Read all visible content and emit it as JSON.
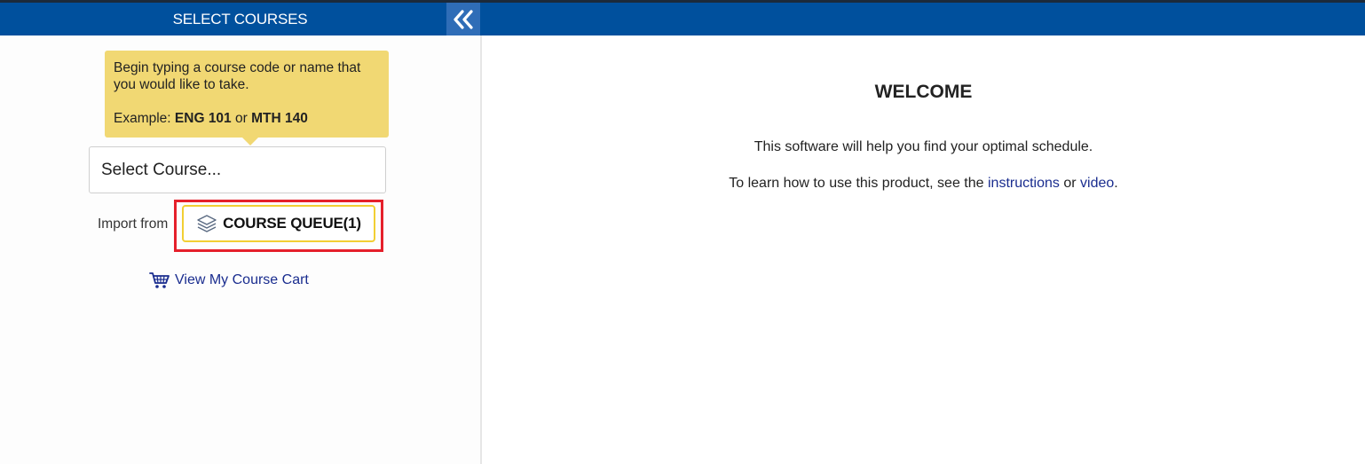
{
  "header": {
    "title": "SELECT COURSES",
    "collapse_icon": "double-chevron-left-icon"
  },
  "sidebar": {
    "tooltip": {
      "line1": "Begin typing a course code or name that you would like to take.",
      "example_prefix": "Example: ",
      "example_code1": "ENG 101",
      "example_or": " or ",
      "example_code2": "MTH 140"
    },
    "select_placeholder": "Select Course...",
    "import_label": "Import from",
    "queue_button_label": "COURSE QUEUE(1)",
    "queue_icon": "layers-icon",
    "cart_link_label": "View My Course Cart",
    "cart_icon": "shopping-cart-icon"
  },
  "main": {
    "welcome_title": "WELCOME",
    "description": "This software will help you find your optimal schedule.",
    "learn_prefix": "To learn how to use this product, see the ",
    "instructions_link": "instructions",
    "learn_or": " or ",
    "video_link": "video",
    "learn_suffix": "."
  },
  "colors": {
    "header_bg": "#00509d",
    "collapse_bg": "#2f6db7",
    "tooltip_bg": "#f1d873",
    "highlight": "#e5202b",
    "button_border": "#f2cf33",
    "link": "#1a2d8f"
  }
}
